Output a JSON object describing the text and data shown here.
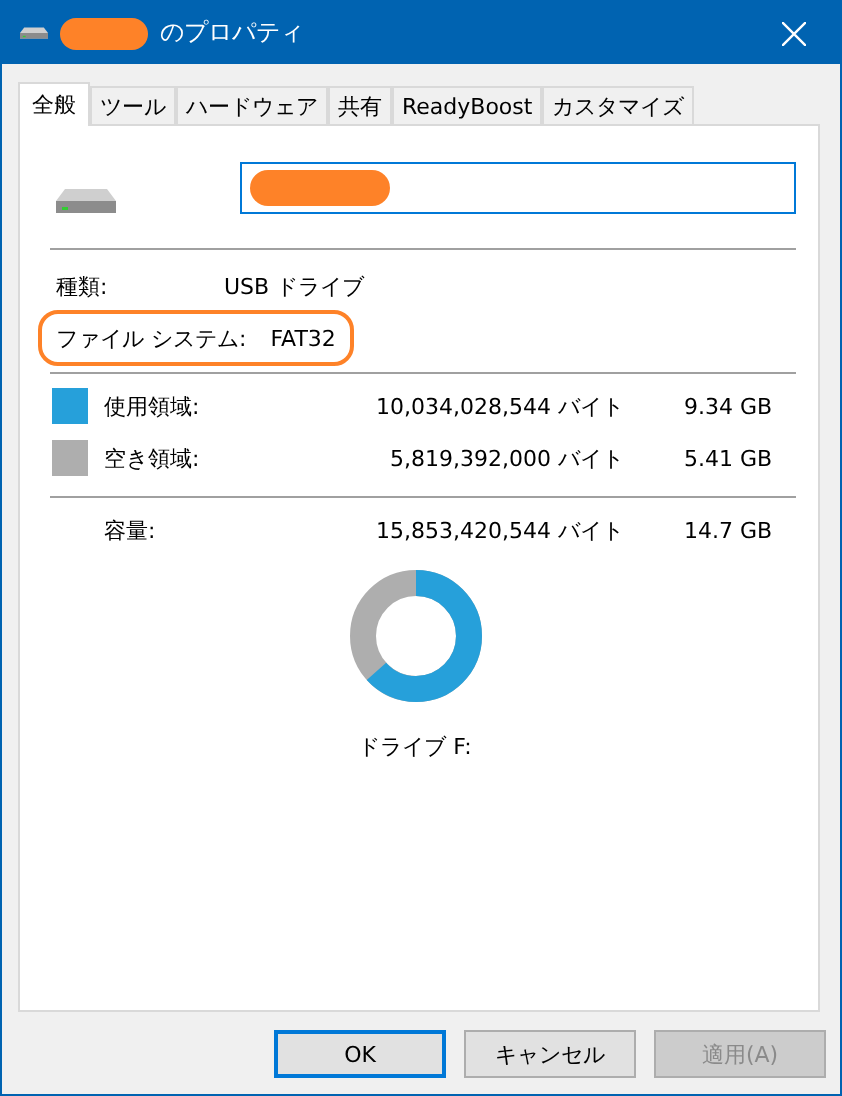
{
  "window": {
    "title": "のプロパティ",
    "title_redacted": true
  },
  "tabs": [
    {
      "label": "全般",
      "selected": true
    },
    {
      "label": "ツール",
      "selected": false
    },
    {
      "label": "ハードウェア",
      "selected": false
    },
    {
      "label": "共有",
      "selected": false
    },
    {
      "label": "ReadyBoost",
      "selected": false
    },
    {
      "label": "カスタマイズ",
      "selected": false
    }
  ],
  "name_field": {
    "value_redacted": true
  },
  "info": [
    {
      "label": "種類:",
      "value": "USB ドライブ",
      "highlighted": false
    },
    {
      "label": "ファイル システム:",
      "value": "FAT32",
      "highlighted": true
    }
  ],
  "space": [
    {
      "label": "使用領域:",
      "bytes": "10,034,028,544 バイト",
      "size": "9.34 GB",
      "color": "#26a0da"
    },
    {
      "label": "空き領域:",
      "bytes": "5,819,392,000 バイト",
      "size": "5.41 GB",
      "color": "#aeaeae"
    }
  ],
  "capacity": {
    "label": "容量:",
    "bytes": "15,853,420,544 バイト",
    "size": "14.7 GB"
  },
  "usage": {
    "level": 0.633
  },
  "drive_label": "ドライブ F:",
  "buttons": [
    {
      "label": "OK",
      "default": true,
      "disabled": false
    },
    {
      "label": "キャンセル",
      "default": false,
      "disabled": false
    },
    {
      "label": "適用(A)",
      "default": false,
      "disabled": true
    }
  ]
}
